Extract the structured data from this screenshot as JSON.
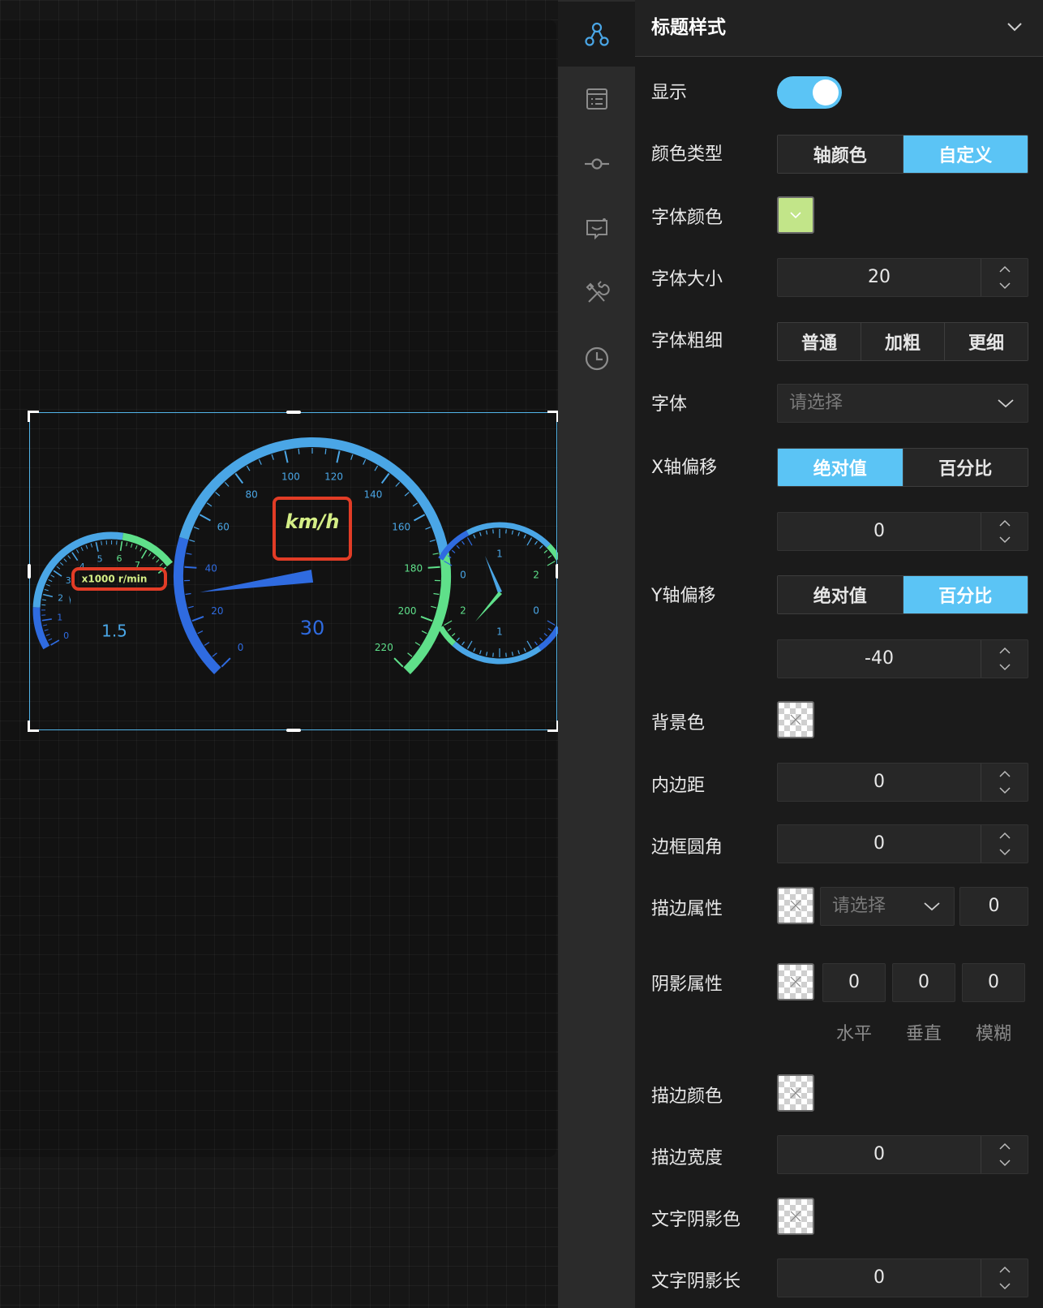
{
  "panel": {
    "title": "标题样式",
    "fields": {
      "show_label": "显示",
      "show_value": true,
      "color_type_label": "颜色类型",
      "color_type_options": [
        "轴颜色",
        "自定义"
      ],
      "color_type_selected": "自定义",
      "font_color_label": "字体颜色",
      "font_color_value": "#c2e589",
      "font_size_label": "字体大小",
      "font_size_value": "20",
      "font_weight_label": "字体粗细",
      "font_weight_options": [
        "普通",
        "加粗",
        "更细"
      ],
      "font_family_label": "字体",
      "font_family_placeholder": "请选择",
      "x_offset_label": "X轴偏移",
      "x_offset_options": [
        "绝对值",
        "百分比"
      ],
      "x_offset_selected": "绝对值",
      "x_offset_value": "0",
      "y_offset_label": "Y轴偏移",
      "y_offset_options": [
        "绝对值",
        "百分比"
      ],
      "y_offset_selected": "百分比",
      "y_offset_value": "-40",
      "bg_color_label": "背景色",
      "padding_label": "内边距",
      "padding_value": "0",
      "border_radius_label": "边框圆角",
      "border_radius_value": "0",
      "border_attr_label": "描边属性",
      "border_attr_placeholder": "请选择",
      "border_attr_width": "0",
      "shadow_attr_label": "阴影属性",
      "shadow_values": [
        "0",
        "0",
        "0"
      ],
      "shadow_captions": [
        "水平",
        "垂直",
        "模糊"
      ],
      "stroke_color_label": "描边颜色",
      "stroke_width_label": "描边宽度",
      "stroke_width_value": "0",
      "text_shadow_color_label": "文字阴影色",
      "text_shadow_length_label": "文字阴影长",
      "text_shadow_length_value": "0"
    }
  },
  "rail": {
    "icons": [
      "nodes-icon",
      "list-icon",
      "axis-icon",
      "tooltip-icon",
      "tools-icon",
      "clock-icon"
    ],
    "active": "nodes-icon"
  },
  "gauges": {
    "rpm": {
      "unit": "x1000 r/min",
      "ticks": [
        "0",
        "1",
        "2",
        "3",
        "4",
        "5",
        "6",
        "7"
      ],
      "value": "1.5",
      "value_num": 1.5,
      "min": 0,
      "max": 8
    },
    "speed": {
      "unit": "km/h",
      "ticks": [
        "0",
        "20",
        "40",
        "60",
        "80",
        "100",
        "120",
        "140",
        "160",
        "180",
        "200",
        "220"
      ],
      "value": "30",
      "value_num": 30,
      "min": 0,
      "max": 220
    },
    "small_top": {
      "ticks": [
        "0",
        "1",
        "2"
      ]
    },
    "small_bottom": {
      "ticks": [
        "2",
        "1",
        "0"
      ]
    }
  },
  "colors": {
    "accent": "#5bc4f5",
    "gauge_blue": "#2f6be0",
    "gauge_cyan": "#4aa6e6",
    "gauge_green": "#5fe08a",
    "highlight_red": "#e23c26",
    "label_yellow": "#d4ee86"
  }
}
